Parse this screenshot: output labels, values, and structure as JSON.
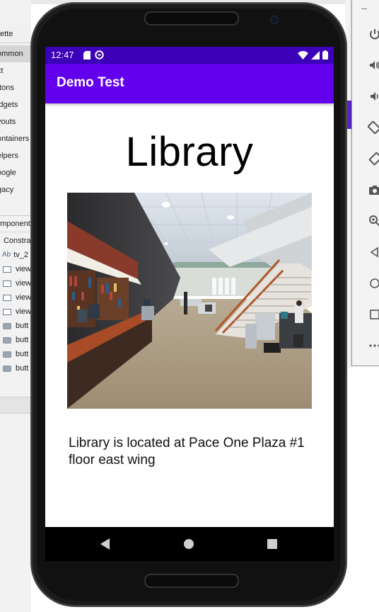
{
  "ide": {
    "palette_header": "ette",
    "palette_items": [
      {
        "label": "ommon",
        "active": true
      },
      {
        "label": "xt",
        "active": false
      },
      {
        "label": "ttons",
        "active": false
      },
      {
        "label": "idgets",
        "active": false
      },
      {
        "label": "youts",
        "active": false
      },
      {
        "label": "ontainers",
        "active": false
      },
      {
        "label": "elpers",
        "active": false
      },
      {
        "label": "oogle",
        "active": false
      },
      {
        "label": "gacy",
        "active": false
      }
    ],
    "component_header": "mponent",
    "tree": {
      "root": "Constra",
      "tv": "tv_2",
      "tv_prefix": "Ab",
      "views": [
        "view",
        "view",
        "view",
        "view"
      ],
      "buttons": [
        "butt",
        "butt",
        "butt",
        "butt"
      ]
    }
  },
  "emulator_controls": [
    "power-icon",
    "volume-up-icon",
    "volume-down-icon",
    "rotate-left-icon",
    "rotate-right-icon",
    "camera-icon",
    "zoom-icon",
    "back-icon",
    "home-icon",
    "overview-icon",
    "more-icon"
  ],
  "phone": {
    "status": {
      "time": "12:47"
    },
    "app_bar": {
      "title": "Demo Test"
    },
    "content": {
      "title": "Library",
      "description": "Library is located at Pace One Plaza #1 floor east wing"
    },
    "colors": {
      "status_bar": "#3b00b8",
      "app_bar": "#6200ee"
    }
  }
}
